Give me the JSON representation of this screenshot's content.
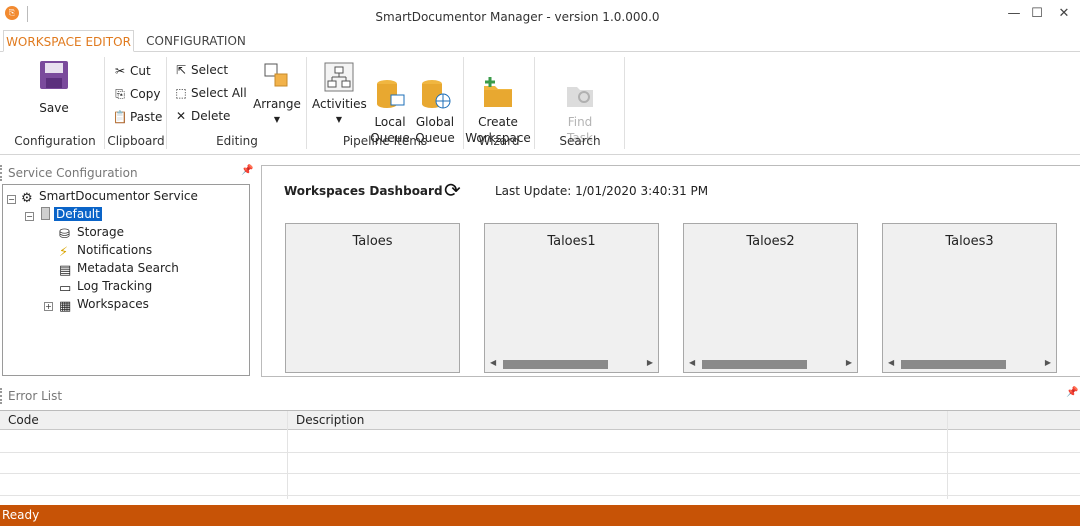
{
  "window": {
    "title": "SmartDocumentor Manager - version 1.0.000.0",
    "minimize": "—",
    "maximize": "☐",
    "close": "✕"
  },
  "tabs": [
    {
      "label": "WORKSPACE EDITOR",
      "active": true
    },
    {
      "label": "CONFIGURATION",
      "active": false
    }
  ],
  "ribbon": {
    "configuration": {
      "label": "Configuration",
      "save": "Save"
    },
    "clipboard": {
      "label": "Clipboard",
      "cut": "Cut",
      "copy": "Copy",
      "paste": "Paste"
    },
    "editing": {
      "label": "Editing",
      "select": "Select",
      "select_all": "Select All",
      "delete": "Delete",
      "arrange": "Arrange"
    },
    "pipeline_items": {
      "label": "Pipeline Items",
      "activities": "Activities",
      "local_queue": "Local\nQueue",
      "global_queue": "Global\nQueue"
    },
    "wizard": {
      "label": "Wizard",
      "create_workspace": "Create\nWorkspace"
    },
    "search": {
      "label": "Search",
      "find_task": "Find\nTask"
    }
  },
  "service_configuration": {
    "title": "Service Configuration",
    "tree": {
      "root": "SmartDocumentor Service",
      "default": "Default",
      "children": [
        "Storage",
        "Notifications",
        "Metadata Search",
        "Log Tracking",
        "Workspaces"
      ]
    }
  },
  "dashboard": {
    "title": "Workspaces Dashboard",
    "last_update": "Last Update: 1/01/2020 3:40:31 PM",
    "workspaces": [
      "Taloes",
      "Taloes1",
      "Taloes2",
      "Taloes3"
    ]
  },
  "error_list": {
    "title": "Error List",
    "columns": [
      "Code",
      "Description",
      ""
    ]
  },
  "status": {
    "text": "Ready"
  },
  "colors": {
    "accent": "#e07a1e",
    "statusbar": "#c75306",
    "selection": "#0a64c8"
  }
}
